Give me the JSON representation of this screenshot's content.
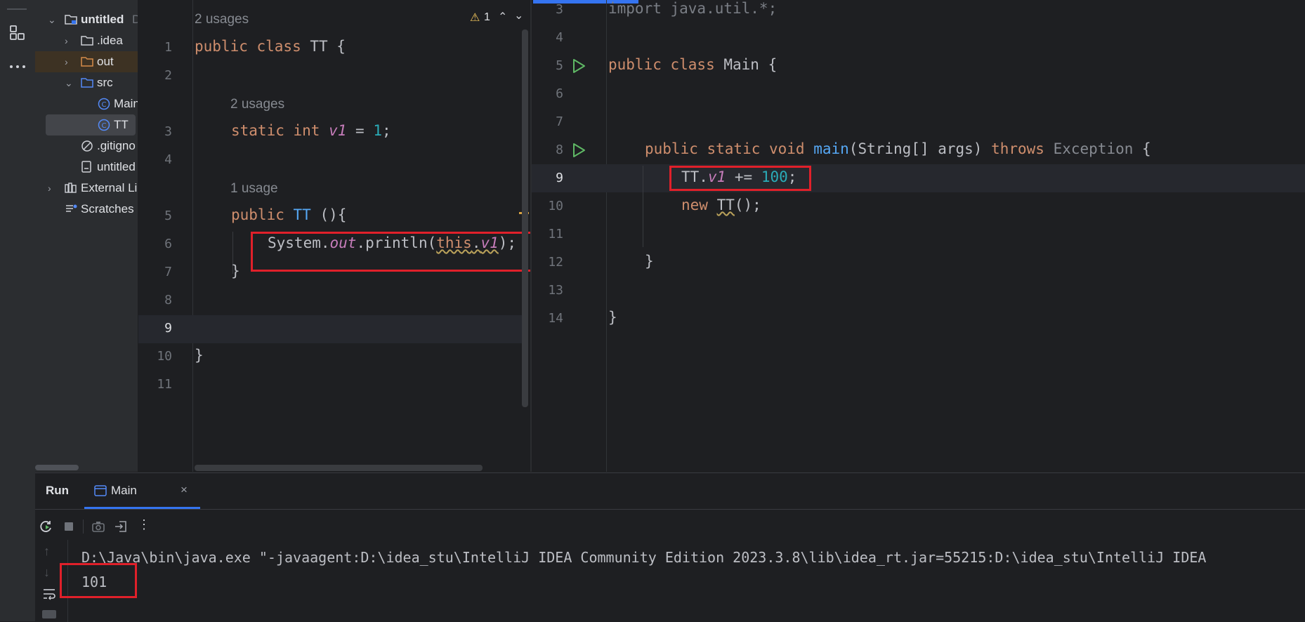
{
  "project_tree": {
    "items": [
      {
        "label": "untitled",
        "suffix": "D"
      },
      {
        "label": ".idea"
      },
      {
        "label": "out"
      },
      {
        "label": "src"
      },
      {
        "label": "Main"
      },
      {
        "label": "TT"
      },
      {
        "label": ".gitigno"
      },
      {
        "label": "untitled"
      },
      {
        "label": "External Li"
      },
      {
        "label": "Scratches"
      }
    ]
  },
  "editor_left": {
    "usages_top": "2 usages",
    "warning_count": "1",
    "lines": {
      "n1": "1",
      "n2": "2",
      "n3": "3",
      "n4": "4",
      "n5": "5",
      "n6": "6",
      "n7": "7",
      "n8": "8",
      "n9": "9",
      "n10": "10",
      "n11": "11"
    },
    "hint_v1": "2 usages",
    "hint_ctor": "1 usage",
    "code": {
      "l1_kw": "public class ",
      "l1_name": "TT {",
      "l3_kw": "static int ",
      "l3_field": "v1",
      "l3_eq": " = ",
      "l3_num": "1",
      "l3_end": ";",
      "l5_kw": "public ",
      "l5_name": "TT",
      "l5_end": " (){",
      "l6_a": "System.",
      "l6_out": "out",
      "l6_b": ".println(",
      "l6_this": "this",
      "l6_dot": ".",
      "l6_field": "v1",
      "l6_end": ");",
      "l7": "}",
      "l10": "}"
    }
  },
  "editor_right": {
    "lines": {
      "n3": "3",
      "n4": "4",
      "n5": "5",
      "n6": "6",
      "n7": "7",
      "n8": "8",
      "n9": "9",
      "n10": "10",
      "n11": "11",
      "n12": "12",
      "n13": "13",
      "n14": "14"
    },
    "code": {
      "l3": "import java.util.*;",
      "l5_kw": "public class ",
      "l5_name": "Main {",
      "l8_kw": "public static void ",
      "l8_fn": "main",
      "l8_args": "(String[] args) ",
      "l8_throws": "throws ",
      "l8_exc": "Exception",
      "l8_end": " {",
      "l9_a": "TT.",
      "l9_field": "v1",
      "l9_op": " += ",
      "l9_num": "100",
      "l9_end": ";",
      "l10_kw": "new ",
      "l10_cls": "TT",
      "l10_end": "();",
      "l12": "}",
      "l14": "}"
    }
  },
  "run_panel": {
    "title": "Run",
    "tab_label": "Main",
    "command_line": "D:\\Java\\bin\\java.exe \"-javaagent:D:\\idea_stu\\IntelliJ IDEA Community Edition 2023.3.8\\lib\\idea_rt.jar=55215:D:\\idea_stu\\IntelliJ IDEA",
    "output": "101"
  },
  "colors": {
    "keyword": "#cf8e6d",
    "field": "#c77dbb",
    "number": "#2aacb8",
    "function": "#56a8f5",
    "highlight_box": "#e0202a"
  }
}
